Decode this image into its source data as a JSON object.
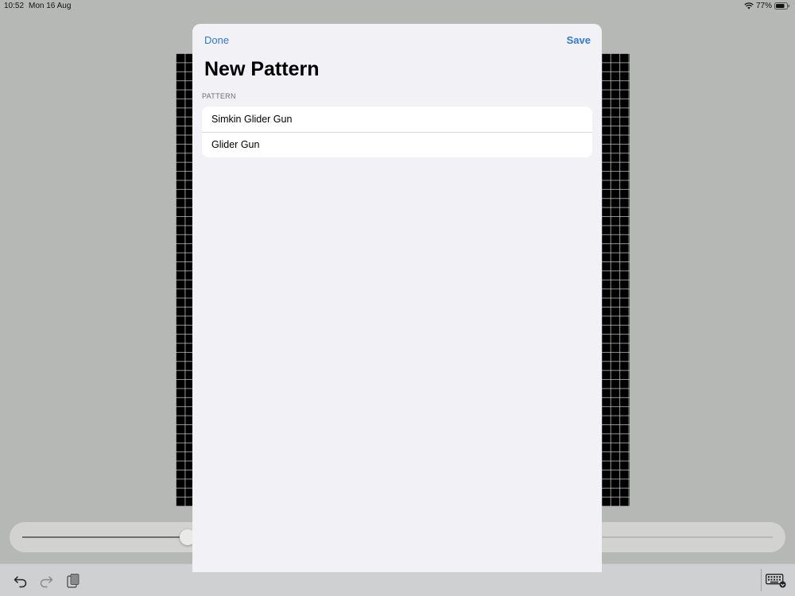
{
  "status_bar": {
    "time": "10:52",
    "date": "Mon 16 Aug",
    "battery": "77%",
    "icons": [
      "wifi-icon",
      "battery-icon"
    ]
  },
  "slider": {
    "value": 0.22
  },
  "sheet": {
    "done_label": "Done",
    "save_label": "Save",
    "title": "New Pattern",
    "section_header": "PATTERN",
    "patterns": [
      {
        "label": "Simkin Glider Gun"
      },
      {
        "label": "Glider Gun"
      }
    ]
  },
  "toolbar": {
    "icons": [
      "undo-icon",
      "redo-icon",
      "paste-icon",
      "keyboard-icon"
    ]
  },
  "colors": {
    "accent": "#2f7ad6",
    "sheet_background": "#f1f1f6",
    "backdrop": "#b6b8b6"
  }
}
